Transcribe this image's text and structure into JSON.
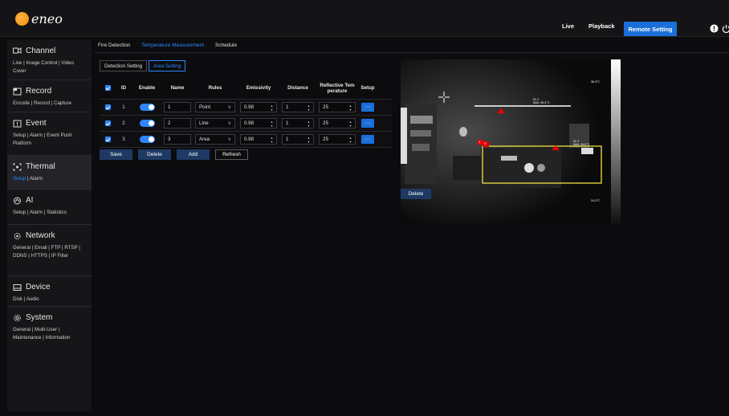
{
  "header": {
    "logo_text": "eneo",
    "nav": [
      "Live",
      "Playback",
      "Remote Setting"
    ],
    "icons": [
      "alert-icon",
      "power-icon"
    ],
    "accent": "#1a6fd9"
  },
  "sidebar": {
    "sections": [
      {
        "title": "Channel",
        "icon": "channel-icon",
        "links": "Live | Image Control | Video Cover"
      },
      {
        "title": "Record",
        "icon": "record-icon",
        "links": "Encode | Record | Capture"
      },
      {
        "title": "Event",
        "icon": "event-icon",
        "links": "Setup | Alarm | Event Push Platform"
      },
      {
        "title": "Thermal",
        "icon": "thermal-icon",
        "links_active": "Setup",
        "links_rest": " | Alarm"
      },
      {
        "title": "AI",
        "icon": "ai-icon",
        "links": "Setup | Alarm | Statistics"
      },
      {
        "title": "Network",
        "icon": "network-icon",
        "links": "General | Email | FTP | RTSP | DDNS | HTTPS | IP Filter"
      },
      {
        "title": "Device",
        "icon": "device-icon",
        "links": "Disk | Audio"
      },
      {
        "title": "System",
        "icon": "system-icon",
        "links": "General | Multi-User | Maintenance | Information"
      }
    ]
  },
  "tabs": [
    "Fire Detection",
    "Temperature Measurement",
    "Schedule"
  ],
  "subtabs": [
    "Detection Setting",
    "Area Setting"
  ],
  "table": {
    "headers": [
      "ID",
      "Enable",
      "Name",
      "Rules",
      "Emissivity",
      "Distance",
      "Reflective Tem perature",
      "Setup"
    ],
    "rows": [
      {
        "id": "1",
        "name": "1",
        "rule": "Point",
        "emissivity": "0.98",
        "distance": "1",
        "reflective": "25",
        "setup": "···"
      },
      {
        "id": "2",
        "name": "2",
        "rule": "Line",
        "emissivity": "0.98",
        "distance": "1",
        "reflective": "25",
        "setup": "···"
      },
      {
        "id": "3",
        "name": "3",
        "rule": "Area",
        "emissivity": "0.98",
        "distance": "1",
        "reflective": "25",
        "setup": "···"
      }
    ]
  },
  "buttons": {
    "save": "Save",
    "delete": "Delete",
    "add": "Add",
    "refresh": "Refresh",
    "delete_view": "Delete"
  },
  "thermal_view": {
    "scale_max": "36.2°C",
    "scale_min": "24.2°C",
    "line_label_id": "ID: 2",
    "line_label_max": "MAX: 26.3 °C",
    "area_label_id": "ID: 3",
    "area_label_max": "MAX: 26.8 °C",
    "point_marker": "1",
    "area_marker": "3"
  }
}
